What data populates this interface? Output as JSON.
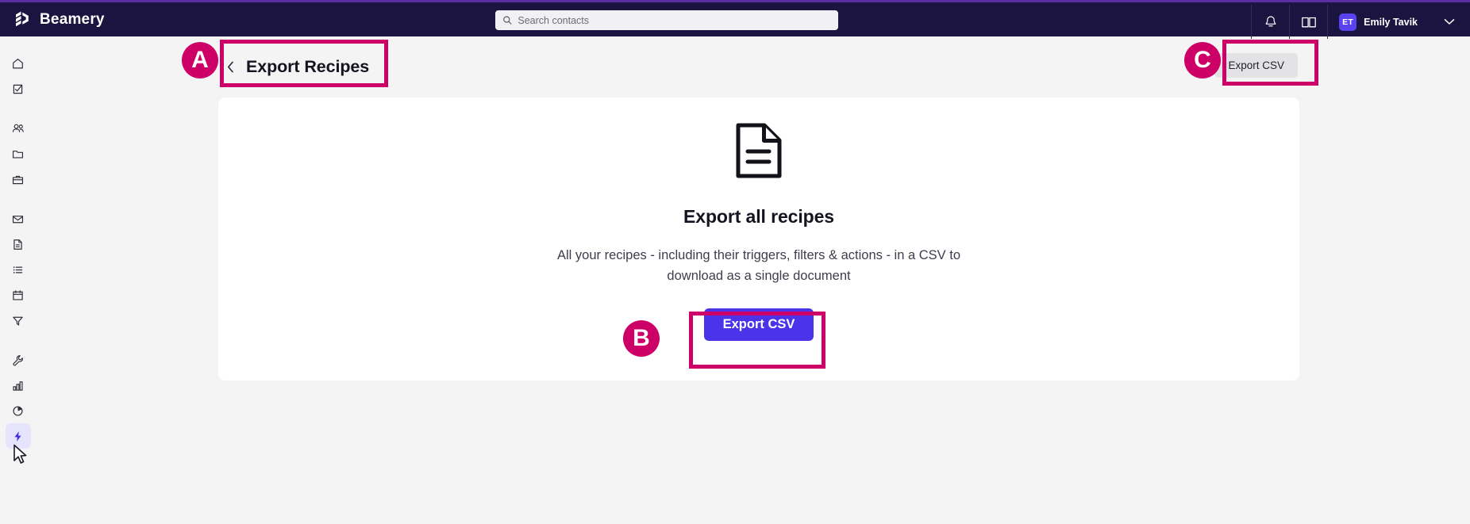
{
  "topbar": {
    "brand_name": "Beamery",
    "brand_logo_icon": "beamery-hexagon-logo",
    "search": {
      "placeholder": "Search contacts",
      "value": "",
      "icon": "search-icon"
    },
    "notifications_icon": "bell-icon",
    "knowledge_icon": "book-icon",
    "user": {
      "initials": "ET",
      "name": "Emily Tavik"
    },
    "caret_icon": "chevron-down-icon",
    "background_color": "#1b1340",
    "accent_color": "#5b2ea6"
  },
  "sidebar": {
    "items": [
      {
        "name": "home",
        "icon": "home-icon",
        "active": false
      },
      {
        "name": "tasks",
        "icon": "task-check-icon",
        "active": false
      },
      {
        "name": "contacts",
        "icon": "people-icon",
        "active": false
      },
      {
        "name": "projects",
        "icon": "folder-icon",
        "active": false
      },
      {
        "name": "jobs",
        "icon": "briefcase-icon",
        "active": false
      },
      {
        "name": "messages",
        "icon": "mail-icon",
        "active": false
      },
      {
        "name": "pages",
        "icon": "document-icon",
        "active": false
      },
      {
        "name": "lists",
        "icon": "list-icon",
        "active": false
      },
      {
        "name": "calendar",
        "icon": "calendar-icon",
        "active": false
      },
      {
        "name": "filters",
        "icon": "funnel-icon",
        "active": false
      },
      {
        "name": "settings",
        "icon": "wrench-icon",
        "active": false
      },
      {
        "name": "reports",
        "icon": "bar-chart-icon",
        "active": false
      },
      {
        "name": "analytics",
        "icon": "pie-chart-icon",
        "active": false
      },
      {
        "name": "automations",
        "icon": "lightning-bolt-icon",
        "active": true
      }
    ],
    "active_highlight_color": "#e6e4fd",
    "active_icon_color": "#3c2ce0"
  },
  "page_header": {
    "back_icon": "chevron-left-icon",
    "title": "Export Recipes",
    "export_button_label": "Export CSV"
  },
  "card": {
    "icon": "document-lines-icon",
    "heading": "Export all recipes",
    "description": "All your recipes - including their triggers, filters & actions - in a CSV to download as a single document",
    "primary_button_label": "Export CSV",
    "primary_button_color": "#4b33ea"
  },
  "annotations": {
    "color": "#cc0066",
    "markers": [
      {
        "label": "A",
        "target": "page-title-back"
      },
      {
        "label": "B",
        "target": "card-export-csv-button"
      },
      {
        "label": "C",
        "target": "header-export-csv-button"
      }
    ]
  },
  "cursor": {
    "icon": "mouse-pointer-icon"
  }
}
